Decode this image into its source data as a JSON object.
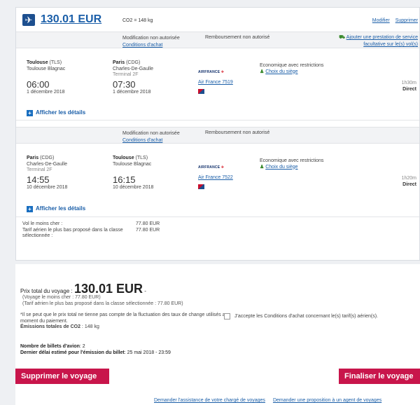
{
  "trip": {
    "price": "130.01 EUR",
    "co2": "CO2 = 148 kg",
    "modify_link": "Modifier",
    "delete_link": "Supprimer"
  },
  "outbound": {
    "modification": "Modification non autorisée",
    "purchase_conditions": "Conditions d'achat",
    "refund": "Remboursement non autorisé",
    "add_service_line1": "Ajouter une prestation de service",
    "add_service_line2": "facultative sur le(s) vol(s)",
    "dep_city": "Toulouse",
    "dep_code": " (TLS)",
    "dep_airport": "Toulouse Blagnac",
    "dep_time": "06:00",
    "dep_date": "1 décembre 2018",
    "arr_city": "Paris",
    "arr_code": " (CDG)",
    "arr_airport": "Charles-De-Gaulle",
    "arr_terminal": "Terminal 2F",
    "arr_time": "07:30",
    "arr_date": "1 décembre 2018",
    "airline_logo": "AIRFRANCE",
    "flight": "Air France 7519",
    "cabin": "Economique avec restrictions",
    "seat_choice": "Choix du siège",
    "duration": "1h30m",
    "stops": "Direct",
    "details": "Afficher les détails"
  },
  "return": {
    "modification": "Modification non autorisée",
    "purchase_conditions": "Conditions d'achat",
    "refund": "Remboursement non autorisé",
    "dep_city": "Paris",
    "dep_code": " (CDG)",
    "dep_airport": "Charles-De-Gaulle",
    "dep_terminal": "Terminal 2F",
    "dep_time": "14:55",
    "dep_date": "10 décembre 2018",
    "arr_city": "Toulouse",
    "arr_code": " (TLS)",
    "arr_airport": "Toulouse Blagnac",
    "arr_time": "16:15",
    "arr_date": "10 décembre 2018",
    "airline_logo": "AIRFRANCE",
    "flight": "Air France 7522",
    "cabin": "Economique avec restrictions",
    "seat_choice": "Choix du siège",
    "duration": "1h20m",
    "stops": "Direct",
    "details": "Afficher les détails"
  },
  "fare": {
    "cheapest_label": "Vol le moins cher :",
    "cheapest_value": "77.80 EUR",
    "class_label_1": "Tarif aérien le plus bas proposé dans la classe",
    "class_label_2": "sélectionnée :",
    "class_value": "77.80 EUR"
  },
  "summary": {
    "total_label": "Prix total du voyage : ",
    "total_value": "130.01 EUR",
    "total_suffix": " -",
    "sub1": "(Voyage le moins cher : 77.80 EUR)",
    "sub2": "(Tarif aérien le plus bas proposé dans la classe sélectionnée : 77.80 EUR)",
    "disclaimer": "*Il se peut que le prix total ne tienne pas compte de la fluctuation des taux de change utilisés au moment du paiement.",
    "co2_label": "Émissions totales de CO2",
    "co2_value": " : 148 kg",
    "accept_label": "J'accepte les Conditions d'achat concernant le(s) tarif(s) aérien(s).",
    "tickets_label": "Nombre de billets d'avion",
    "tickets_value": ": 2",
    "deadline_label": "Dernier délai estimé pour l'émission du billet",
    "deadline_value": ":  25 mai 2018 - 23:59",
    "delete_button": "Supprimer le voyage",
    "finalize_button": "Finaliser le voyage"
  },
  "footer": {
    "assist_link": "Demander l'assistance de votre chargé de voyages",
    "proposal_link": "Demander une proposition à un agent de voyages"
  },
  "colors": {
    "link": "#1a5ea8",
    "primary_button": "#c8154b",
    "plane_badge": "#1d4f8f"
  }
}
